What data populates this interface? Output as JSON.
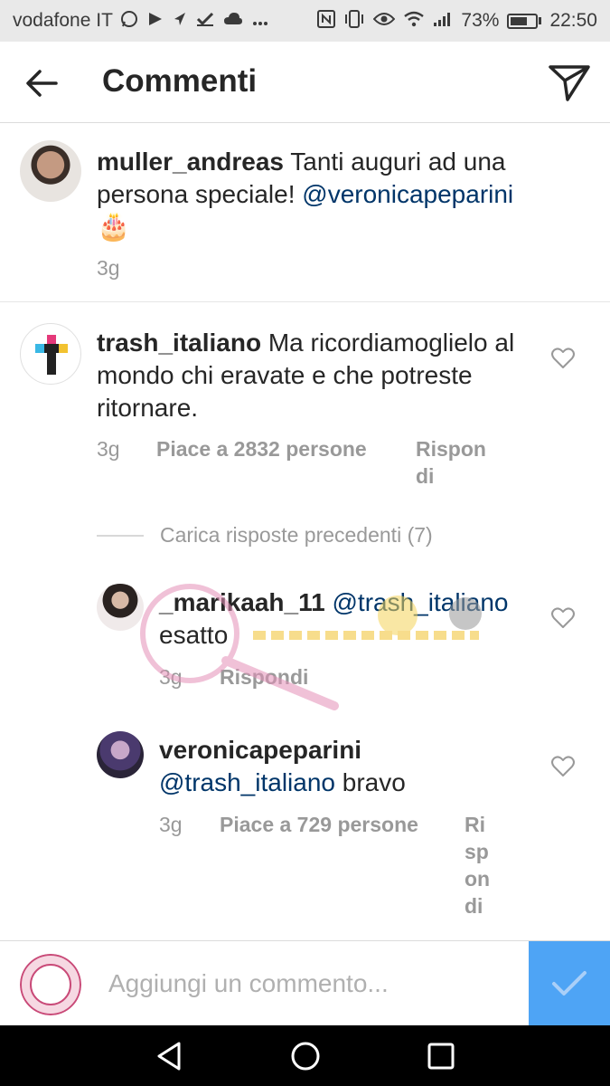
{
  "status_bar": {
    "carrier": "vodafone IT",
    "notif_icons": [
      "whatsapp-icon",
      "message-icon",
      "telegram-icon",
      "check-icon",
      "cloud-icon",
      "more-icon"
    ],
    "battery": "73%",
    "battery_level": 0.73,
    "time": "22:50"
  },
  "header": {
    "title": "Commenti",
    "back_icon": "arrow-left-icon",
    "send_icon": "paper-plane-icon"
  },
  "caption": {
    "username": "muller_andreas",
    "text": "Tanti auguri ad una persona speciale! ",
    "mention": "@veronicapeparini",
    "emoji": "🎂",
    "time": "3g"
  },
  "comments": [
    {
      "username": "trash_italiano",
      "text": "Ma ricordiamoglielo al mondo chi eravate e che potreste ritornare.",
      "time": "3g",
      "likes": "Piace a 2832 persone",
      "reply_line1": "Rispon",
      "reply_line2": "di"
    }
  ],
  "load_replies": "Carica risposte precedenti (7)",
  "replies": [
    {
      "username": "_marikaah_11",
      "mention": "@trash_italiano",
      "text": "esatto",
      "time": "3g",
      "reply": "Rispondi"
    },
    {
      "username": "veronicapeparini",
      "mention": "@trash_italiano",
      "text": " bravo",
      "time": "3g",
      "likes": "Piace a 729 persone",
      "reply_parts": [
        "Ri",
        "sp",
        "on",
        "di"
      ]
    }
  ],
  "input": {
    "placeholder": "Aggiungi un commento..."
  },
  "colors": {
    "mention": "#003569",
    "meta": "#999999",
    "submit": "#4ea4f5"
  }
}
